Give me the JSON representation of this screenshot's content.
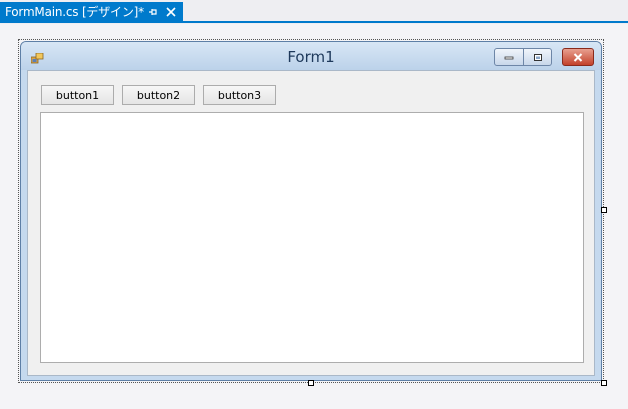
{
  "doc_tab": {
    "title": "FormMain.cs [デザイン]*",
    "pin_icon": "pin-icon",
    "close_icon": "close-icon"
  },
  "form": {
    "title": "Form1",
    "icon": "form-icon",
    "buttons": [
      {
        "label": "button1"
      },
      {
        "label": "button2"
      },
      {
        "label": "button3"
      }
    ],
    "window_controls": [
      "minimize-icon",
      "maximize-icon",
      "close-icon"
    ]
  },
  "colors": {
    "accent": "#007acc",
    "form_frame": "#c5d9ee",
    "close_button": "#c3412b"
  }
}
